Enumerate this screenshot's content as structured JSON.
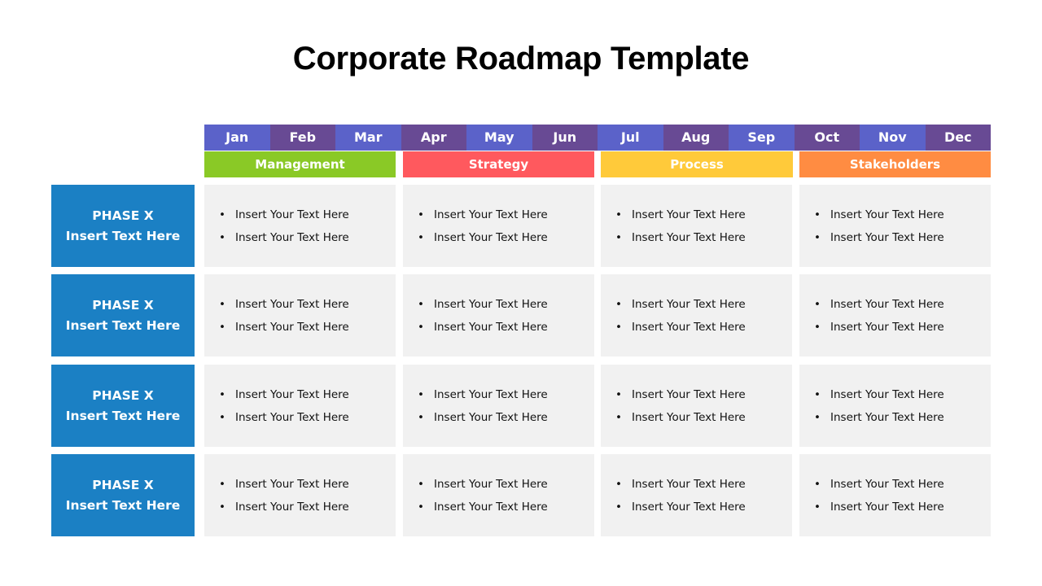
{
  "title": "Corporate Roadmap Template",
  "months": [
    "Jan",
    "Feb",
    "Mar",
    "Apr",
    "May",
    "Jun",
    "Jul",
    "Aug",
    "Sep",
    "Oct",
    "Nov",
    "Dec"
  ],
  "month_colors": {
    "odd": "#5b62c9",
    "even": "#684a94"
  },
  "categories": [
    {
      "label": "Management",
      "color": "#8ac926"
    },
    {
      "label": "Strategy",
      "color": "#ff595e"
    },
    {
      "label": "Process",
      "color": "#ffca3a"
    },
    {
      "label": "Stakeholders",
      "color": "#ff8c42"
    }
  ],
  "phase_color": "#1b80c4",
  "rows": [
    {
      "phase": "PHASE X",
      "subtitle": "Insert Text Here",
      "cells": [
        [
          "Insert Your Text Here",
          "Insert Your Text Here"
        ],
        [
          "Insert Your Text Here",
          "Insert Your Text Here"
        ],
        [
          "Insert Your Text Here",
          "Insert Your Text Here"
        ],
        [
          "Insert Your Text Here",
          "Insert Your Text Here"
        ]
      ]
    },
    {
      "phase": "PHASE X",
      "subtitle": "Insert Text Here",
      "cells": [
        [
          "Insert Your Text Here",
          "Insert Your Text Here"
        ],
        [
          "Insert Your Text Here",
          "Insert Your Text Here"
        ],
        [
          "Insert Your Text Here",
          "Insert Your Text Here"
        ],
        [
          "Insert Your Text Here",
          "Insert Your Text Here"
        ]
      ]
    },
    {
      "phase": "PHASE X",
      "subtitle": "Insert Text Here",
      "cells": [
        [
          "Insert Your Text Here",
          "Insert Your Text Here"
        ],
        [
          "Insert Your Text Here",
          "Insert Your Text Here"
        ],
        [
          "Insert Your Text Here",
          "Insert Your Text Here"
        ],
        [
          "Insert Your Text Here",
          "Insert Your Text Here"
        ]
      ]
    },
    {
      "phase": "PHASE X",
      "subtitle": "Insert Text Here",
      "cells": [
        [
          "Insert Your Text Here",
          "Insert Your Text Here"
        ],
        [
          "Insert Your Text Here",
          "Insert Your Text Here"
        ],
        [
          "Insert Your Text Here",
          "Insert Your Text Here"
        ],
        [
          "Insert Your Text Here",
          "Insert Your Text Here"
        ]
      ]
    }
  ]
}
